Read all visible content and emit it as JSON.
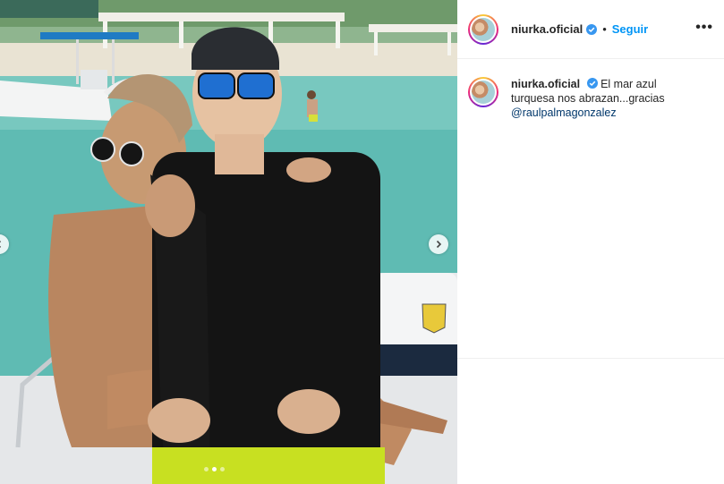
{
  "post": {
    "username": "niurka.oficial",
    "separator": "•",
    "follow_label": "Seguir",
    "more_label": "•••",
    "caption_text": "El mar azul turquesa nos abrazan...gracias",
    "caption_mention": "@raulpalmagonzalez",
    "carousel": {
      "total": 3,
      "active_index": 1
    }
  },
  "colors": {
    "accent": "#0095f6",
    "text": "#262626",
    "mention": "#00376b",
    "verified": "#3897f0"
  },
  "icons": {
    "verified": "verified-badge-icon",
    "next": "chevron-right-icon",
    "prev": "chevron-left-icon",
    "more": "more-options-icon"
  }
}
